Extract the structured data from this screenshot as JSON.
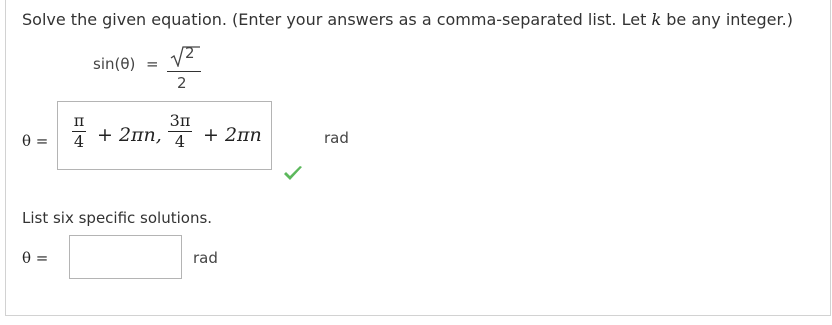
{
  "question": {
    "prompt_pre": "Solve the given equation. (Enter your answers as a comma-separated list. Let ",
    "prompt_var": "k",
    "prompt_post": " be any integer.)"
  },
  "equation": {
    "lhs": "sin(θ)",
    "equals": "=",
    "rhs_num": "2",
    "rhs_den": "2"
  },
  "answer1": {
    "label": "θ =",
    "term1_num": "π",
    "term1_den": "4",
    "term1_tail": "+ 2πn,",
    "term2_num": "3π",
    "term2_den": "4",
    "term2_tail": "+ 2πn",
    "unit": "rad",
    "status": "correct",
    "check_color": "#5cb85c"
  },
  "list": {
    "prompt": "List six specific solutions.",
    "label": "θ =",
    "value": "",
    "placeholder": "",
    "unit": "rad"
  }
}
